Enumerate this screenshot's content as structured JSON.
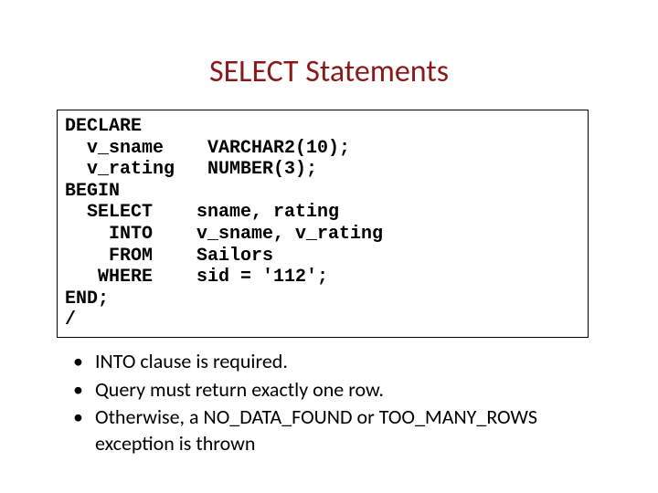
{
  "title": "SELECT Statements",
  "code": "DECLARE\n  v_sname    VARCHAR2(10);\n  v_rating   NUMBER(3);\nBEGIN\n  SELECT    sname, rating\n    INTO    v_sname, v_rating\n    FROM    Sailors\n   WHERE    sid = '112';\nEND;\n/",
  "bullets": [
    "INTO clause is required.",
    "Query must return exactly one row.",
    "Otherwise, a NO_DATA_FOUND or TOO_MANY_ROWS exception is thrown"
  ]
}
